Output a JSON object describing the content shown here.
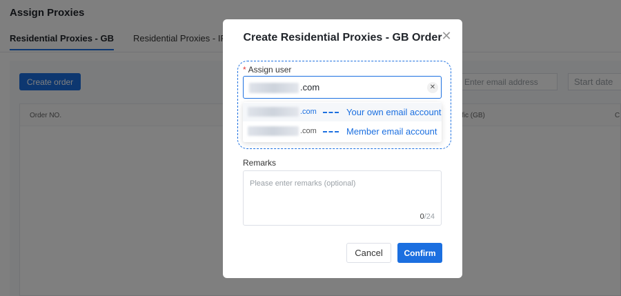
{
  "page": {
    "title": "Assign Proxies",
    "tabs": [
      {
        "label": "Residential Proxies - GB",
        "active": true
      },
      {
        "label": "Residential Proxies - IPs",
        "active": false
      }
    ],
    "create_order_label": "Create order",
    "email_filter_placeholder": "Enter email address",
    "start_date_placeholder": "Start date",
    "table_headers": {
      "order_no": "Order NO.",
      "traffic": "fic (GB)",
      "partial": "C"
    }
  },
  "modal": {
    "title": "Create Residential Proxies - GB Order",
    "close_icon": "close-icon",
    "assign_user": {
      "required_mark": "*",
      "label": "Assign user",
      "selected_suffix": ".com",
      "options": [
        {
          "suffix": ".com",
          "note": "Your own email account"
        },
        {
          "suffix": ".com",
          "note": "Member email account"
        }
      ]
    },
    "remarks": {
      "label": "Remarks",
      "placeholder": "Please enter remarks (optional)",
      "count": "0",
      "max": "/24"
    },
    "cancel_label": "Cancel",
    "confirm_label": "Confirm"
  },
  "colors": {
    "accent": "#1b6fe0",
    "overlay": "rgba(0,0,0,0.5)"
  }
}
